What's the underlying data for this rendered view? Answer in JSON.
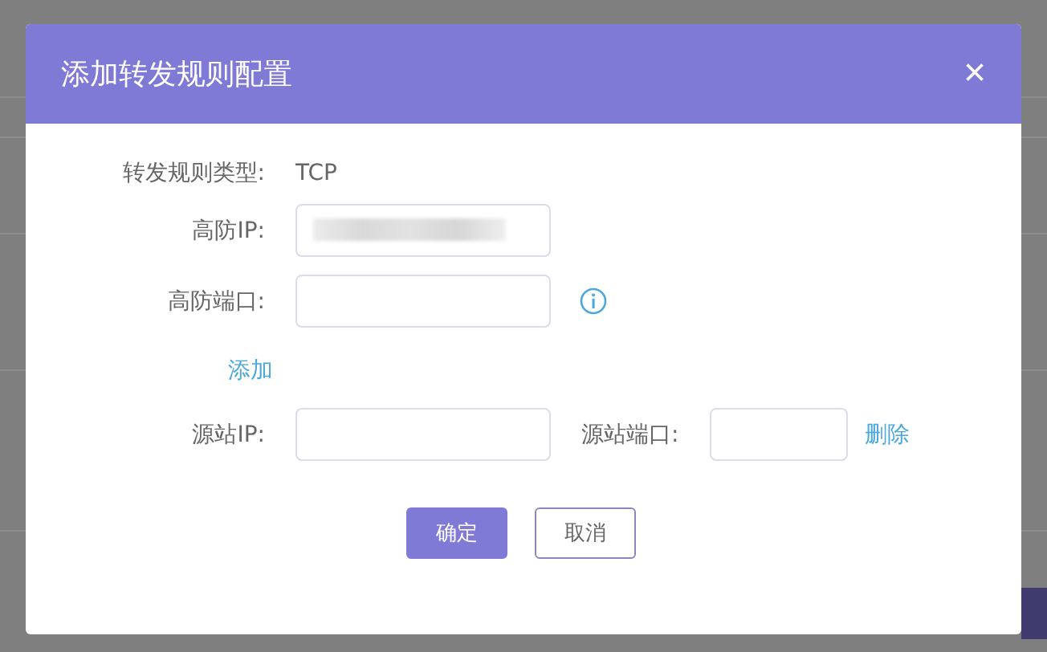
{
  "dialog": {
    "title": "添加转发规则配置",
    "close": "×"
  },
  "type_row": {
    "label": "转发规则类型:",
    "value": "TCP"
  },
  "ip_row": {
    "label": "高防IP:",
    "redacted": true
  },
  "port_row": {
    "label": "高防端口:",
    "info": true
  },
  "add_link": "添加",
  "source_rows": [
    {
      "ip_label": "源站IP:",
      "port_label": "源站端口:",
      "delete": "删除"
    }
  ],
  "buttons": [
    {
      "label": "确定",
      "kind": "primary"
    },
    {
      "label": "取消",
      "kind": "secondary"
    }
  ]
}
